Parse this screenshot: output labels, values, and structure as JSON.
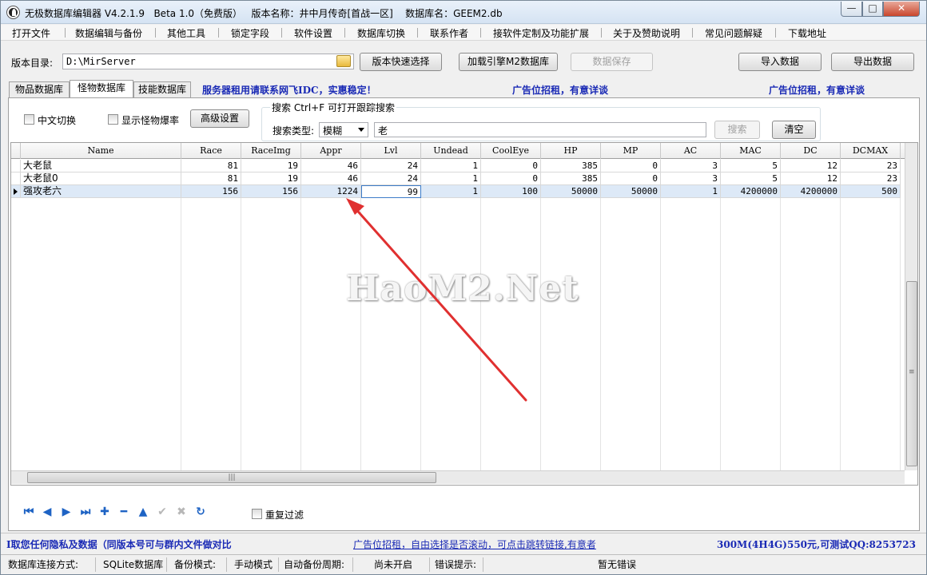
{
  "window": {
    "title": "无极数据库编辑器 V4.2.1.9   Beta 1.0（免费版）   版本名称：井中月传奇[首战一区]    数据库名：GEEM2.db",
    "min": "—",
    "max": "□",
    "close": "✕"
  },
  "menu": [
    "打开文件",
    "数据编辑与备份",
    "其他工具",
    "锁定字段",
    "软件设置",
    "数据库切换",
    "联系作者",
    "接软件定制及功能扩展",
    "关于及赞助说明",
    "常见问题解疑",
    "下载地址"
  ],
  "toolbar": {
    "dir_label": "版本目录:",
    "dir_value": "D:\\MirServer",
    "quick_select": "版本快速选择",
    "load_engine": "加载引擎M2数据库",
    "save_data": "数据保存",
    "import": "导入数据",
    "export": "导出数据"
  },
  "tabs": [
    "物品数据库",
    "怪物数据库",
    "技能数据库"
  ],
  "ads": {
    "server": "服务器租用请联系网飞IDC，实惠稳定！",
    "ad1": "广告位招租，有意详谈",
    "ad2": "广告位招租，有意详谈"
  },
  "options": {
    "chinese_switch": "中文切换",
    "show_drop_rate": "显示怪物爆率",
    "advanced": "高级设置"
  },
  "search": {
    "title": "搜索  Ctrl+F 可打开跟踪搜索",
    "type_label": "搜索类型:",
    "type_value": "模糊",
    "query": "老",
    "search_btn": "搜索",
    "clear_btn": "清空"
  },
  "grid": {
    "columns": [
      "Name",
      "Race",
      "RaceImg",
      "Appr",
      "Lvl",
      "Undead",
      "CoolEye",
      "HP",
      "MP",
      "AC",
      "MAC",
      "DC",
      "DCMAX"
    ],
    "rows": [
      [
        "大老鼠",
        "81",
        "19",
        "46",
        "24",
        "1",
        "0",
        "385",
        "0",
        "3",
        "5",
        "12",
        "23"
      ],
      [
        "大老鼠0",
        "81",
        "19",
        "46",
        "24",
        "1",
        "0",
        "385",
        "0",
        "3",
        "5",
        "12",
        "23"
      ],
      [
        "强攻老六",
        "156",
        "156",
        "1224",
        "99",
        "1",
        "100",
        "50000",
        "50000",
        "1",
        "4200000",
        "4200000",
        "500"
      ]
    ],
    "hscroll_grip": "|||",
    "vscroll_grip": "≡"
  },
  "nav": {
    "first": "⏮",
    "prev": "◀",
    "next": "▶",
    "last": "⏭",
    "add": "✚",
    "delete": "━",
    "up": "▲",
    "post": "✔",
    "cancel": "✖",
    "refresh": "↻",
    "dedupe": "重复过滤"
  },
  "adbar": {
    "left": "I取您任何隐私及数据（同版本号可与群内文件做对比",
    "middle": "广告位招租，自由选择是否滚动，可点击跳转链接,有意者",
    "right": "300M(4H4G)550元,可测试QQ:8253723"
  },
  "status": {
    "conn_label": "数据库连接方式:",
    "conn_value": "SQLite数据库",
    "backup_label": "备份模式:",
    "backup_value": "手动模式",
    "auto_label": "自动备份周期:",
    "auto_value": "尚未开启",
    "err_label": "错误提示:",
    "err_value": "暂无错误"
  },
  "watermark": "HaoM2.Net",
  "colors": {
    "ad_blue": "#1a2ab5",
    "arrow_red": "#e03030",
    "selection": "#dde9f7"
  }
}
